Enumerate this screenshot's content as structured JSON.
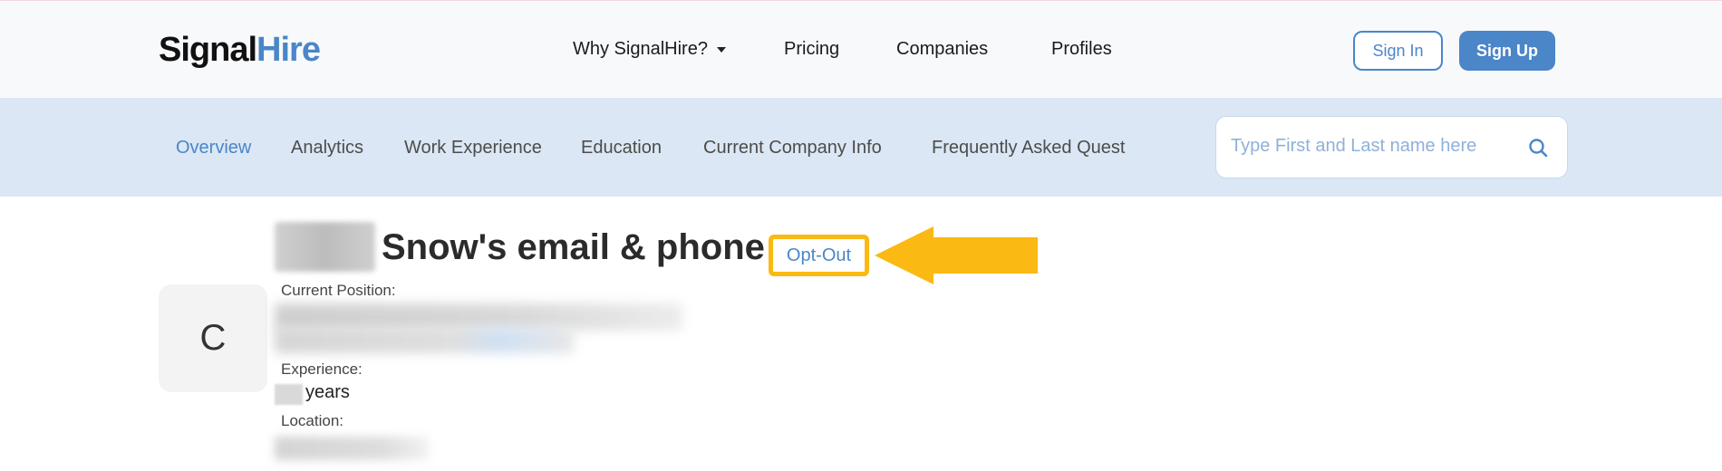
{
  "header": {
    "logo_part1": "Signal",
    "logo_part2": "Hire",
    "nav": [
      {
        "label": "Why SignalHire?",
        "has_dropdown": true
      },
      {
        "label": "Pricing"
      },
      {
        "label": "Companies"
      },
      {
        "label": "Profiles"
      }
    ],
    "sign_in": "Sign In",
    "sign_up": "Sign Up"
  },
  "subnav": {
    "tabs": [
      {
        "label": "Overview",
        "active": true
      },
      {
        "label": "Analytics"
      },
      {
        "label": "Work Experience"
      },
      {
        "label": "Education"
      },
      {
        "label": "Current Company Info"
      },
      {
        "label": "Frequently Asked Quest"
      }
    ],
    "search_placeholder": "Type First and Last name here"
  },
  "profile": {
    "avatar_initial": "C",
    "headline": "Snow's email & phone",
    "opt_out": "Opt-Out",
    "current_position_label": "Current Position:",
    "experience_label": "Experience:",
    "years_text": "years",
    "location_label": "Location:"
  },
  "colors": {
    "brand_blue": "#4a86c8",
    "subnav_bg": "#dbe7f4",
    "highlight_yellow": "#fbb913"
  },
  "icons": [
    "search-icon",
    "chevron-down-icon",
    "arrow-left-icon"
  ]
}
